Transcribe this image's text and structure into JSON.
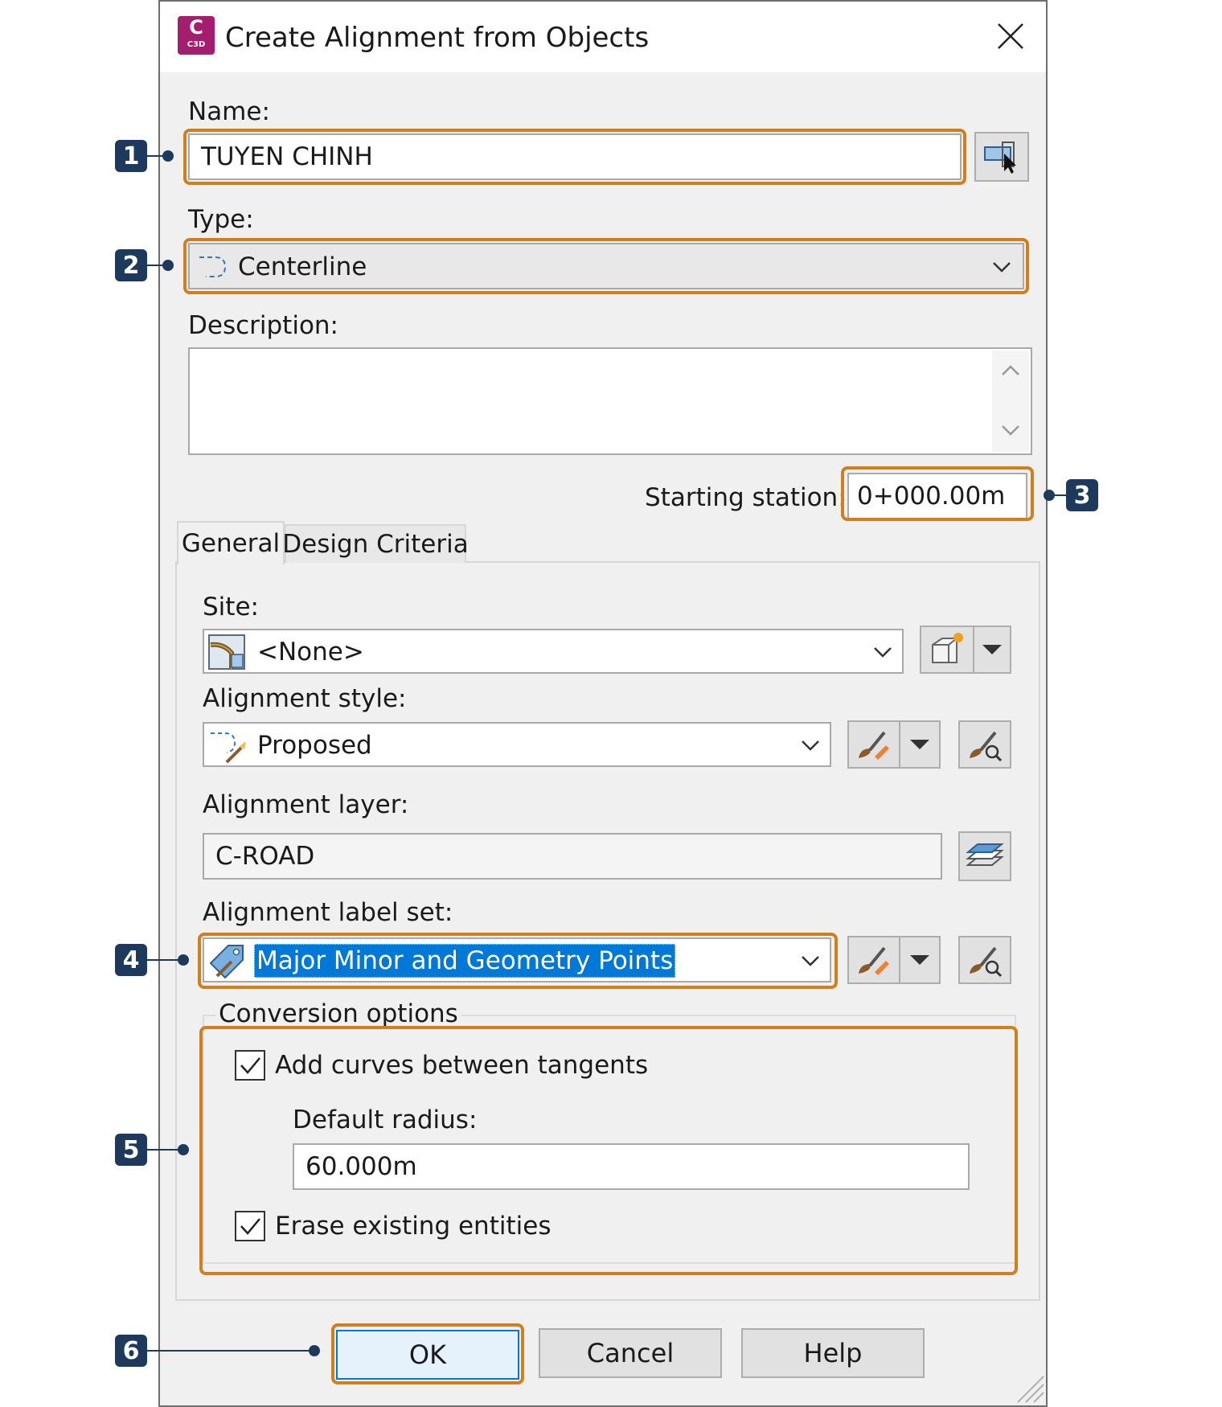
{
  "window": {
    "title": "Create Alignment from Objects",
    "app_badge": "C",
    "app_badge_sub": "C3D"
  },
  "name": {
    "label": "Name:",
    "value": "TUYEN CHINH"
  },
  "type": {
    "label": "Type:",
    "value": "Centerline"
  },
  "description": {
    "label": "Description:",
    "value": ""
  },
  "starting_station": {
    "label": "Starting station:",
    "value": "0+000.00m"
  },
  "tabs": [
    {
      "label": "General",
      "active": true
    },
    {
      "label": "Design Criteria",
      "active": false
    }
  ],
  "site": {
    "label": "Site:",
    "value": "<None>"
  },
  "alignment_style": {
    "label": "Alignment style:",
    "value": "Proposed"
  },
  "alignment_layer": {
    "label": "Alignment layer:",
    "value": "C-ROAD"
  },
  "label_set": {
    "label": "Alignment label set:",
    "value": "Major Minor and Geometry Points"
  },
  "conversion": {
    "group_label": "Conversion options",
    "add_curves": {
      "label": "Add curves between tangents",
      "checked": true
    },
    "default_radius": {
      "label": "Default radius:",
      "value": "60.000m"
    },
    "erase_entities": {
      "label": "Erase existing entities",
      "checked": true
    }
  },
  "buttons": {
    "ok": "OK",
    "cancel": "Cancel",
    "help": "Help"
  },
  "callouts": [
    "1",
    "2",
    "3",
    "4",
    "5",
    "6"
  ],
  "colors": {
    "highlight": "#d17e1d",
    "callout": "#1d3a5c",
    "selection": "#0078d7",
    "app_icon": "#a51d6f"
  }
}
